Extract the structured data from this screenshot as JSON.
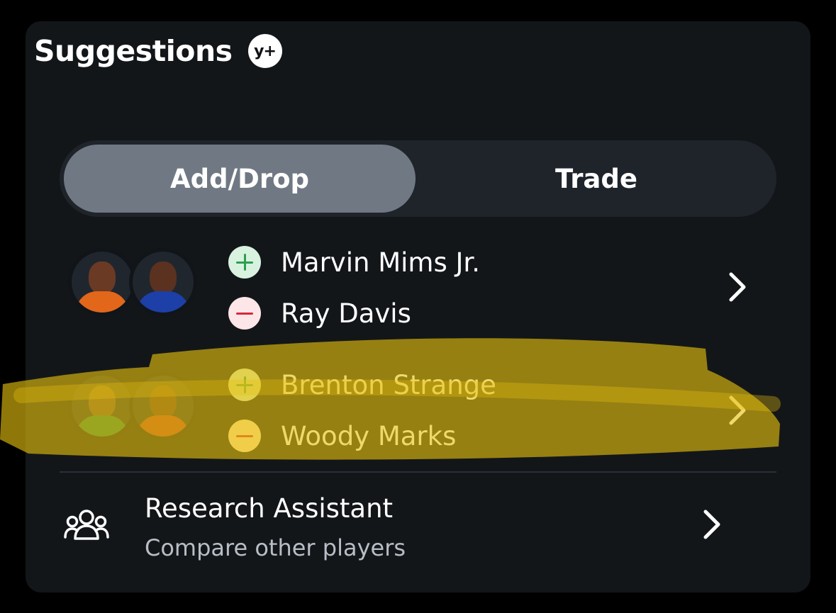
{
  "header": {
    "title": "Suggestions",
    "badge": "y+"
  },
  "tabs": [
    {
      "label": "Add/Drop",
      "active": true
    },
    {
      "label": "Trade",
      "active": false
    }
  ],
  "suggestions": [
    {
      "add_player": "Marvin Mims Jr.",
      "drop_player": "Ray Davis",
      "add_jersey_color": "#e2671b",
      "drop_jersey_color": "#1d3fa8",
      "highlighted": false
    },
    {
      "add_player": "Brenton Strange",
      "drop_player": "Woody Marks",
      "add_jersey_color": "#1f7a3a",
      "drop_jersey_color": "#b23a1c",
      "highlighted": true
    }
  ],
  "research": {
    "title": "Research Assistant",
    "subtitle": "Compare other players"
  },
  "colors": {
    "card_bg": "#131619",
    "active_tab_bg": "#707983",
    "add_green": "#2e9e4f",
    "drop_red": "#d9263a",
    "highlight_yellow": "#f5c518"
  }
}
